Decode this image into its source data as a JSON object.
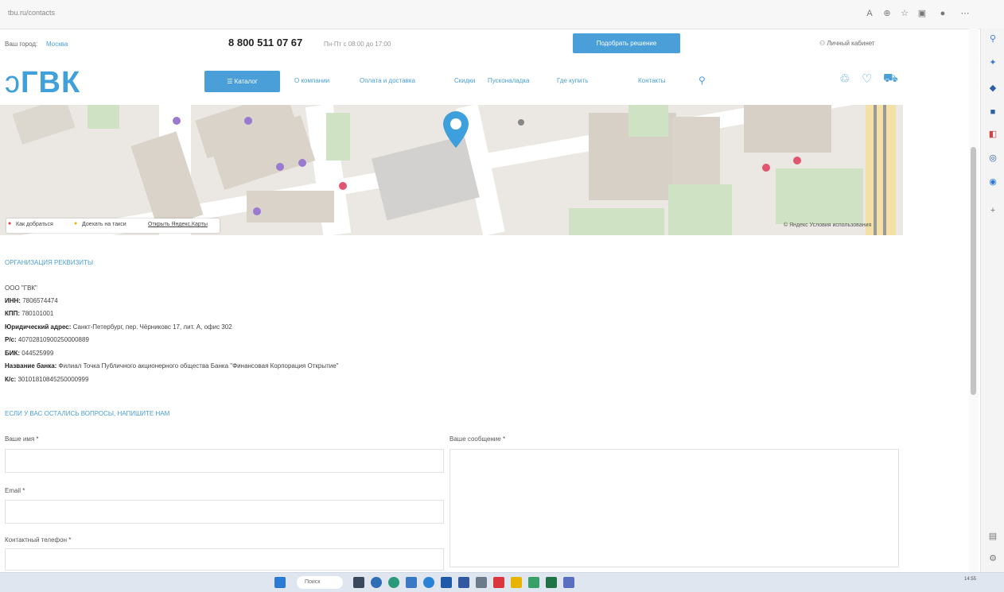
{
  "browser": {
    "url": "tbu.ru/contacts",
    "toolbar_icons": [
      "translate-icon",
      "zoom-icon",
      "star-icon",
      "collections-icon",
      "profile-icon",
      "menu-icon"
    ]
  },
  "header": {
    "city_label": "Ваш город:",
    "city_value": "Москва",
    "phone": "8 800 511 07 67",
    "hours": "Пн-Пт с 08:00 до 17:00",
    "pick_button": "Подобрать решение",
    "cabinet": "Личный кабинет",
    "logo": "ГВК",
    "catalog_button": "Каталог",
    "nav": [
      "О компании",
      "Оплата и доставка",
      "Скидки",
      "Пусконаладка",
      "Где купить",
      "Контакты"
    ]
  },
  "map": {
    "route_button": "Как добраться",
    "yandex_maps": "Доехать на такси",
    "open_maps": "Открыть Яндекс.Карты",
    "copyright": "© Яндекс Условия использования"
  },
  "requisites": {
    "title": "ОРГАНИЗАЦИЯ РЕКВИЗИТЫ",
    "lines": [
      {
        "label": "",
        "value": "ООО \"ГВК\""
      },
      {
        "label": "ИНН: ",
        "value": "7806574474"
      },
      {
        "label": "КПП: ",
        "value": "780101001"
      },
      {
        "label": "Юридический адрес: ",
        "value": "Санкт-Петербург, пер. Чёрниковс 17, лит. А, офис 302"
      },
      {
        "label": "Р/с: ",
        "value": "40702810900250000889"
      },
      {
        "label": "БИК: ",
        "value": "044525999"
      },
      {
        "label": "Название банка: ",
        "value": "Филиал Точка Публичного акционерного общества Банка \"Финансовая Корпорация Открытие\""
      },
      {
        "label": "К/с: ",
        "value": "30101810845250000999"
      }
    ]
  },
  "form": {
    "title": "ЕСЛИ У ВАС ОСТАЛИСЬ ВОПРОСЫ, НАПИШИТЕ НАМ",
    "name_label": "Ваше имя *",
    "email_label": "Email *",
    "phone_label": "Контактный телефон *",
    "message_label": "Ваше сообщение *"
  },
  "taskbar": {
    "search": "Поиск",
    "clock": "14:55"
  }
}
